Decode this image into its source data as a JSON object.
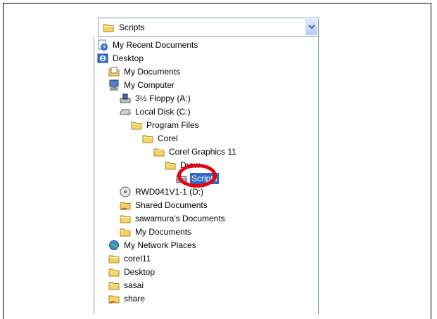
{
  "dialog": {
    "look_in": {
      "label": "Scripts",
      "icon": "folder-icon"
    },
    "items": [
      {
        "label": "My Recent Documents",
        "icon": "recent-documents-icon"
      },
      {
        "label": "Desktop",
        "icon": "desktop-icon"
      },
      {
        "label": "My Documents",
        "icon": "my-documents-icon"
      },
      {
        "label": "My Computer",
        "icon": "my-computer-icon"
      },
      {
        "label": "3½ Floppy (A:)",
        "icon": "floppy-drive-icon"
      },
      {
        "label": "Local Disk (C:)",
        "icon": "hard-disk-icon"
      },
      {
        "label": "Program Files",
        "icon": "folder-icon"
      },
      {
        "label": "Corel",
        "icon": "folder-icon"
      },
      {
        "label": "Corel Graphics 11",
        "icon": "folder-icon"
      },
      {
        "label": "Draw",
        "icon": "folder-icon"
      },
      {
        "label": "Scripts",
        "icon": "folder-icon",
        "selected": true
      },
      {
        "label": "RWD041V1-1 (D:)",
        "icon": "cd-drive-icon"
      },
      {
        "label": "Shared Documents",
        "icon": "shared-folder-icon"
      },
      {
        "label": "sawamura's Documents",
        "icon": "folder-icon"
      },
      {
        "label": "My Documents",
        "icon": "folder-icon"
      },
      {
        "label": "My Network Places",
        "icon": "network-places-icon"
      },
      {
        "label": "corel11",
        "icon": "folder-icon"
      },
      {
        "label": "Desktop",
        "icon": "folder-icon"
      },
      {
        "label": "sasai",
        "icon": "folder-icon"
      },
      {
        "label": "share",
        "icon": "shared-folder-icon"
      }
    ]
  },
  "colors": {
    "selection": "#316ac5",
    "highlight_circle": "#e3000f",
    "folder": "#f5d46b",
    "combo_border": "#7f9db9"
  }
}
